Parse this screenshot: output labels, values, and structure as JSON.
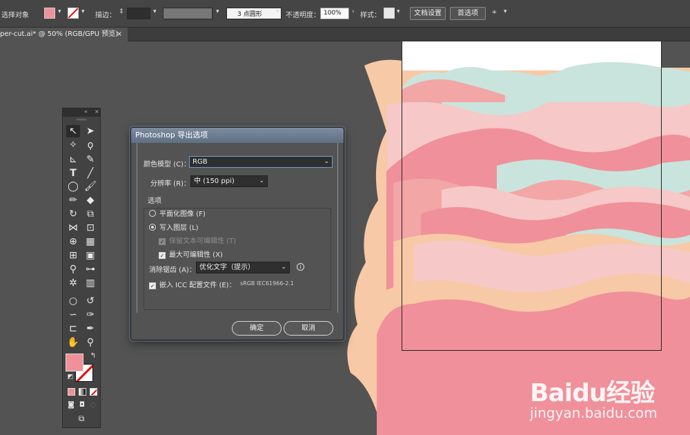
{
  "control_bar": {
    "selection_label": "选择对象",
    "fill_color": "#f0919a",
    "stroke_label": "描边：",
    "brush_label": "3 点圆形",
    "opacity_label": "不透明度：",
    "opacity_value": "100%",
    "style_label": "样式：",
    "doc_setup_button": "文档设置",
    "preferences_button": "首选项"
  },
  "document_tab": {
    "title": "per-cut.ai* @ 50% (RGB/GPU 预览)",
    "close": "×"
  },
  "dialog": {
    "title": "Photoshop 导出选项",
    "color_model_label": "颜色模型 (C)：",
    "color_model_value": "RGB",
    "resolution_label": "分辨率 (R)：",
    "resolution_value": "中 (150 ppi)",
    "options_label": "选项",
    "flat_image_label": "平面化图像 (F)",
    "write_layers_label": "写入图层 (L)",
    "preserve_text_label": "保留文本可编辑性 (T)",
    "max_editability_label": "最大可编辑性 (X)",
    "antialias_label": "消除锯齿 (A)：",
    "antialias_value": "优化文字（提示）",
    "embed_icc_label": "嵌入 ICC 配置文件 (E)：",
    "icc_profile": "sRGB IEC61966-2.1",
    "ok_button": "确定",
    "cancel_button": "取消"
  },
  "tools": {
    "fill_color": "#f0919a",
    "stroke_color": "#ffffff"
  },
  "watermark": {
    "logo_text": "Baidu经验",
    "url": "jingyan.baidu.com"
  },
  "artwork_colors": [
    "#f8c9a6",
    "#f2a6a6",
    "#f0909a",
    "#c9e4dc",
    "#f6c8c8"
  ]
}
